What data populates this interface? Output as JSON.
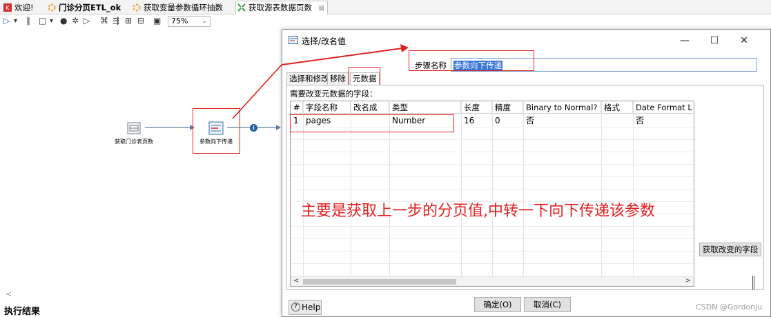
{
  "tabs": [
    {
      "label": "欢迎!",
      "icon": "welcome-icon",
      "bold": false
    },
    {
      "label": "门诊分页ETL_ok",
      "icon": "job-icon",
      "bold": true
    },
    {
      "label": "获取变量参数循环抽数",
      "icon": "job-icon",
      "bold": false
    },
    {
      "label": "获取源表数据页数",
      "icon": "transformation-icon",
      "bold": false,
      "active": true,
      "close": "⊠"
    }
  ],
  "toolbar": {
    "run": "▷",
    "run_dropdown": "▾",
    "pause": "∥",
    "stop": "□",
    "stop_dropdown": "▾",
    "preview": "●",
    "debug": "✲",
    "replay": "▷",
    "verify": "⌘",
    "impact": "⇶",
    "sql": "⊞",
    "explore": "⊟",
    "grid": "▣",
    "zoom": "75%",
    "zoom_dropdown": "⌄"
  },
  "canvas": {
    "step1_label": "获取门诊表页数",
    "step2_label": "参数向下传递",
    "hop_info": "i",
    "scroll_left": "<"
  },
  "results_label": "执行结果",
  "dialog": {
    "title": "选择/改名值",
    "minimize": "—",
    "maximize": "☐",
    "close": "✕",
    "step_name_label": "步骤名称",
    "step_name_value": "参数向下传递",
    "tabs": [
      "选择和修改",
      "移除",
      "元数据"
    ],
    "active_tab": 2,
    "fields_label": "需要改变元数据的字段：",
    "columns": [
      "#",
      "字段名称",
      "改名成",
      "类型",
      "长度",
      "精度",
      "Binary to Normal?",
      "格式",
      "Date Format L"
    ],
    "rows": [
      [
        "1",
        "pages",
        "",
        "Number",
        "16",
        "0",
        "否",
        "",
        "否"
      ]
    ],
    "scroll_left": "<",
    "scroll_right": ">",
    "get_fields_button": "获取改变的字段",
    "annotation": "主要是获取上一步的分页值,中转一下向下传递该参数",
    "help_button": "Help",
    "help_icon": "?",
    "ok_button": "确定(O)",
    "cancel_button": "取消(C)"
  },
  "watermark": "CSDN @Gordonju",
  "colors": {
    "annotation_red": "#e02020",
    "selection_blue": "#3875d7",
    "hop_blue": "#1f5fa8"
  }
}
